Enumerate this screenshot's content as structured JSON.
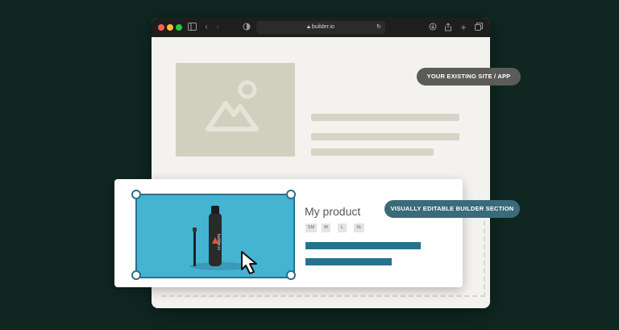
{
  "browser": {
    "url": "builder.io",
    "traffic_lights": [
      "#ff5f57",
      "#febc2e",
      "#28c840"
    ],
    "icons": [
      "sidebar-icon",
      "back-icon",
      "forward-icon",
      "shield-icon",
      "lock-icon",
      "reload-icon",
      "download-icon",
      "share-icon",
      "new-tab-icon",
      "tabs-icon"
    ]
  },
  "labels": {
    "existing_site": "YOUR EXISTING SITE / APP",
    "builder_section": "VISUALLY EDITABLE BUILDER SECTION"
  },
  "product": {
    "title": "My product",
    "sizes": [
      "SM",
      "M",
      "L",
      "XL"
    ]
  },
  "colors": {
    "background": "#0f2621",
    "existing_pill": "#5b5b59",
    "builder_pill": "#3a6b7a",
    "accent": "#24738f",
    "photo_bg": "#45b3d2"
  }
}
